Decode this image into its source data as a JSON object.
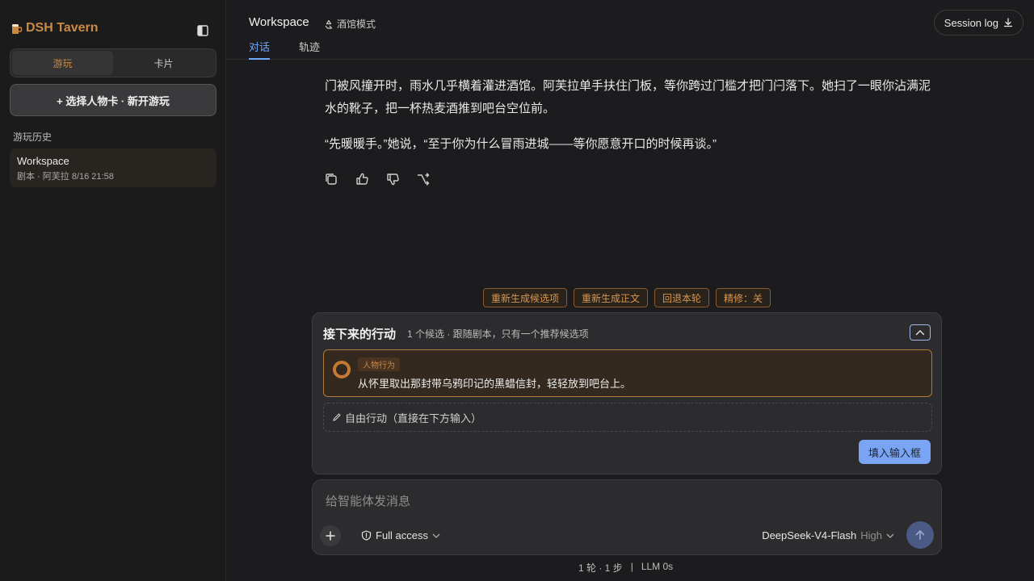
{
  "app": {
    "brand": "DSH Tavern"
  },
  "sidebar": {
    "tabs": [
      {
        "label": "游玩",
        "active": true
      },
      {
        "label": "卡片",
        "active": false
      }
    ],
    "new_button": "+ 选择人物卡 · 新开游玩",
    "history_title": "游玩历史",
    "history": [
      {
        "name": "Workspace",
        "meta": "剧本 · 阿芙拉  8/16 21:58"
      }
    ]
  },
  "header": {
    "title": "Workspace",
    "mode": "酒馆模式",
    "tabs": [
      {
        "label": "对话",
        "active": true
      },
      {
        "label": "轨迹",
        "active": false
      }
    ],
    "session_log": "Session log"
  },
  "message": {
    "paragraphs": [
      "门被风撞开时，雨水几乎横着灌进酒馆。阿芙拉单手扶住门板，等你跨过门槛才把门闩落下。她扫了一眼你沾满泥水的靴子，把一杯热麦酒推到吧台空位前。",
      "“先暖暖手。”她说，“至于你为什么冒雨进城——等你愿意开口的时候再谈。”"
    ]
  },
  "chips": [
    "重新生成候选项",
    "重新生成正文",
    "回退本轮",
    "精修：关"
  ],
  "panel": {
    "title": "接下来的行动",
    "subtitle": "1 个候选 · 跟随剧本，只有一个推荐候选项",
    "option_tag": "人物行为",
    "option_text": "从怀里取出那封带乌鸦印记的黑蜡信封，轻轻放到吧台上。",
    "free_action": "自由行动（直接在下方输入）",
    "fill_button": "填入输入框"
  },
  "composer": {
    "placeholder": "给智能体发消息",
    "access": "Full access",
    "model": "DeepSeek-V4-Flash",
    "effort": "High"
  },
  "status": {
    "rounds": "1 轮 · 1 步",
    "sep": "|",
    "llm": "LLM 0s"
  },
  "colors": {
    "accent": "#6ea8ff",
    "brand": "#c98a45",
    "chip": "#d9974f"
  }
}
